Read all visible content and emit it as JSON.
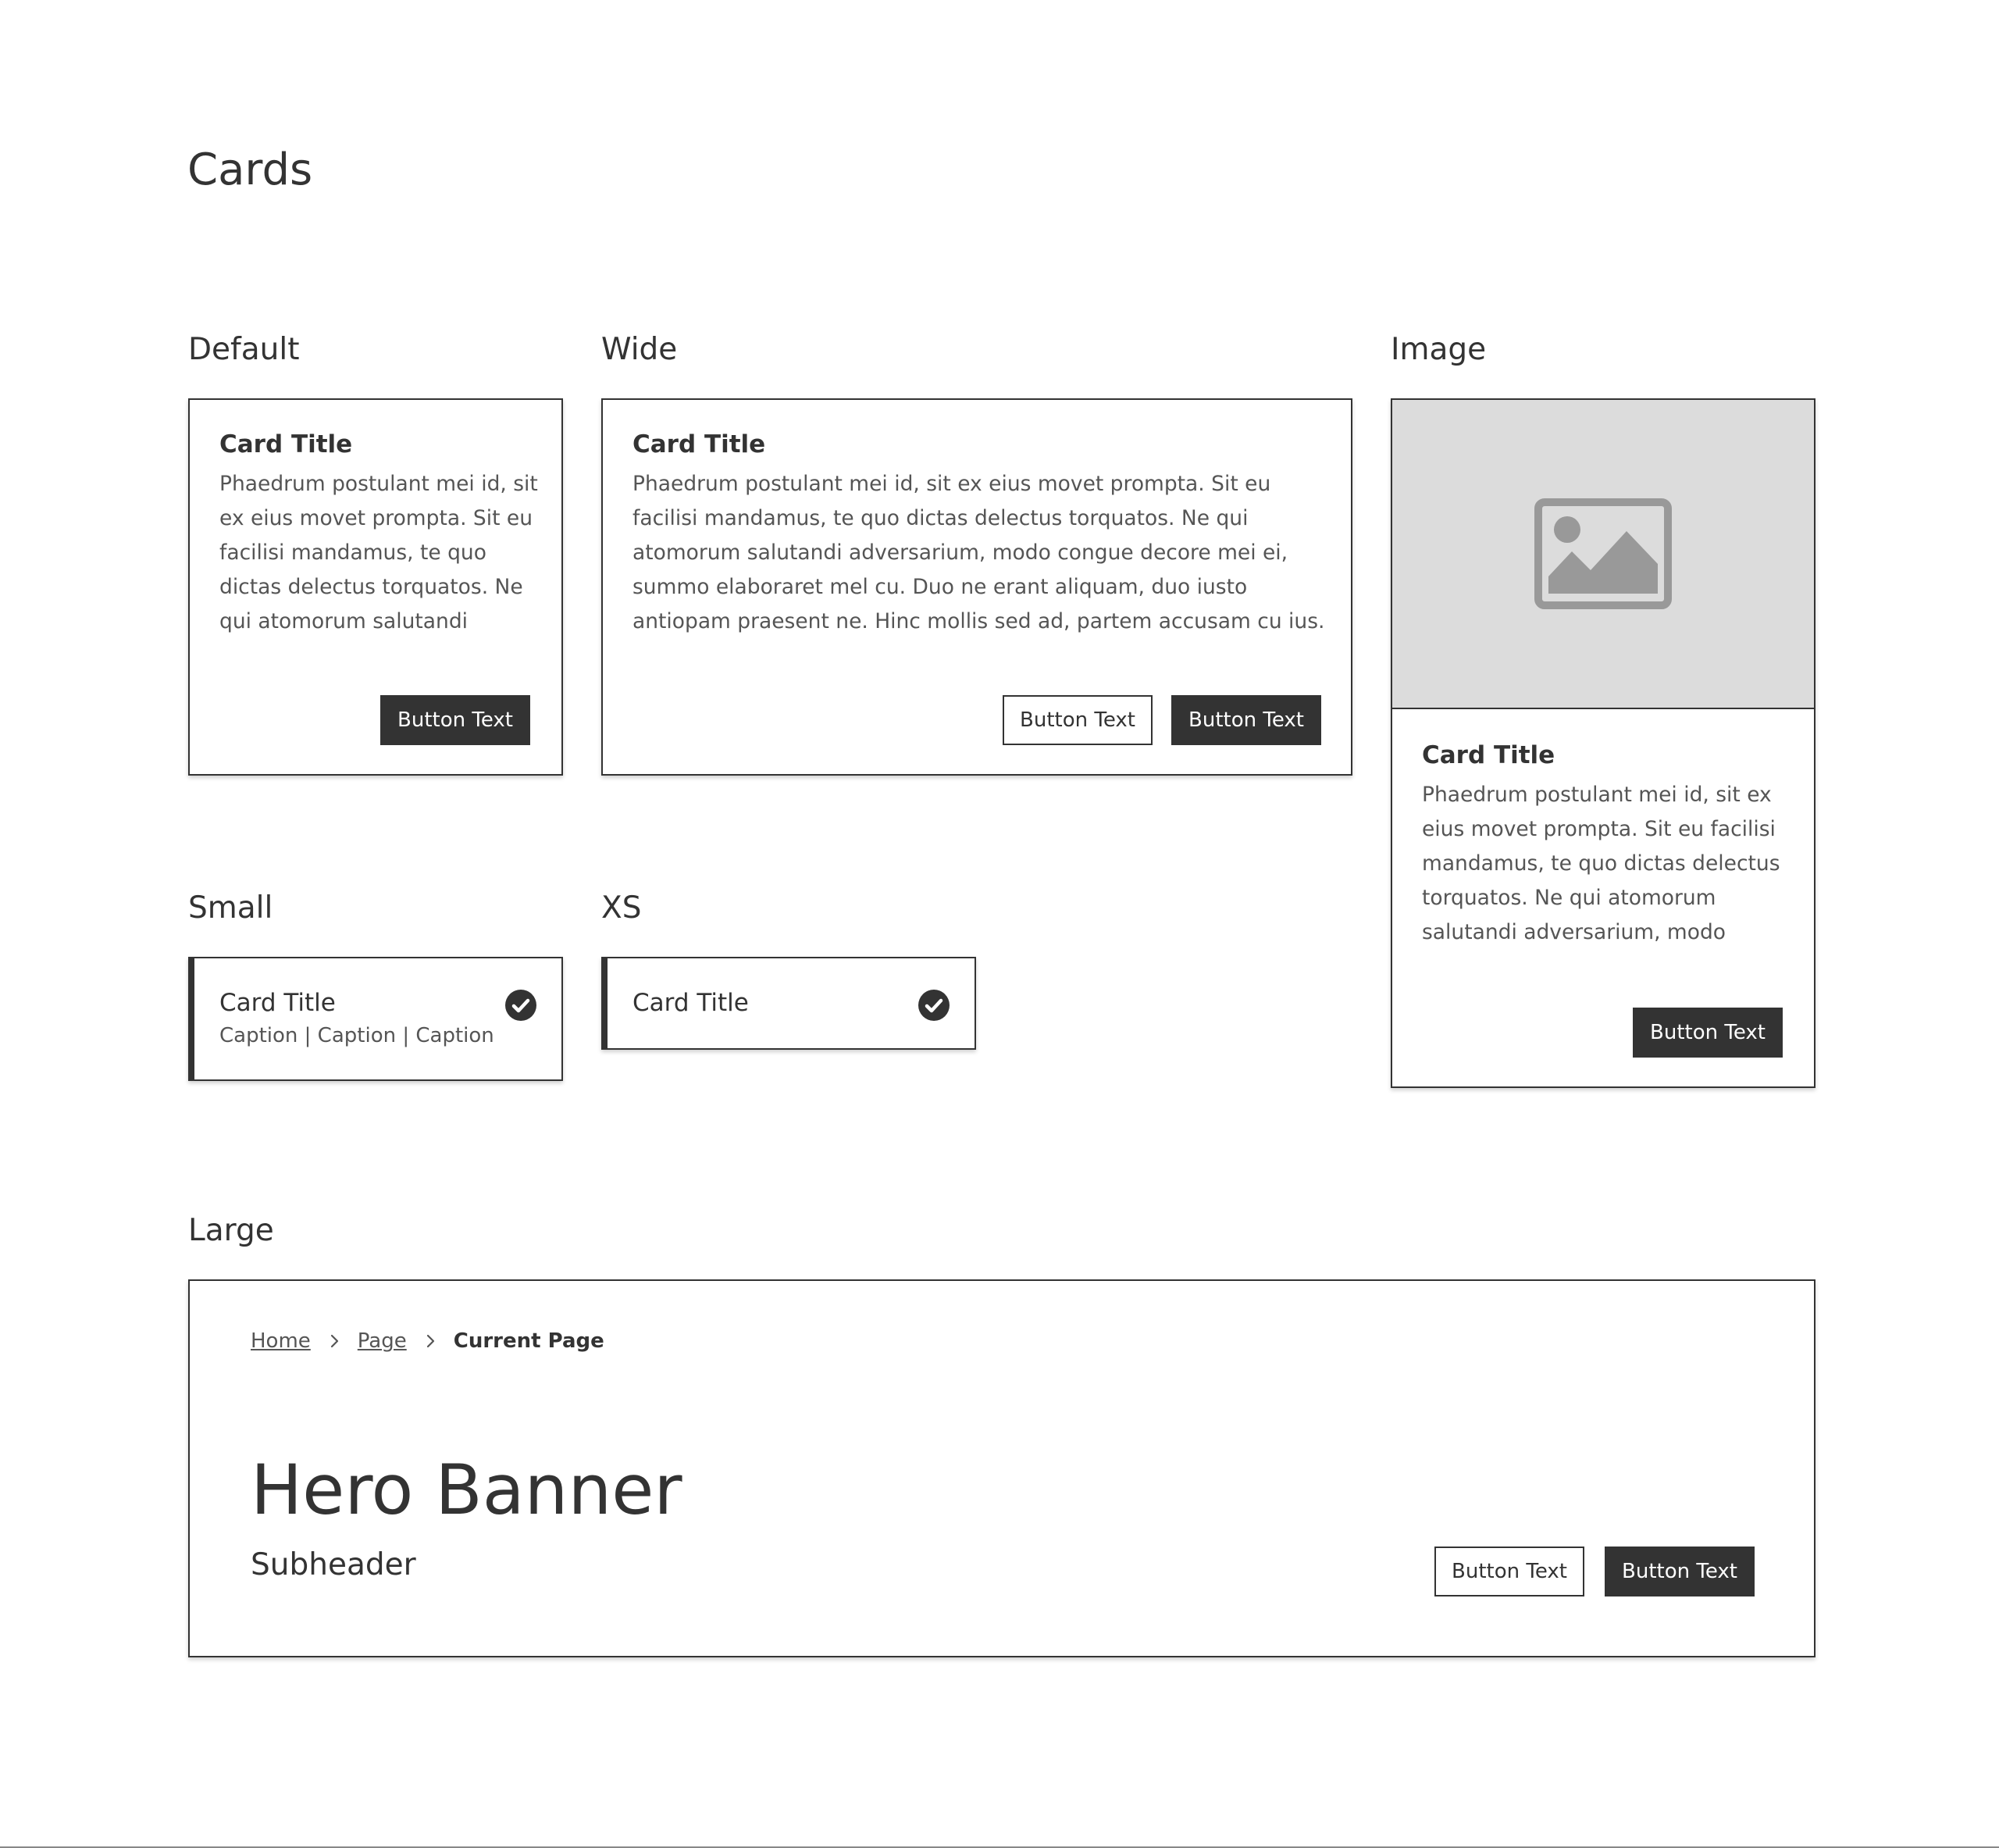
{
  "page": {
    "title": "Cards"
  },
  "sections": {
    "default_label": "Default",
    "wide_label": "Wide",
    "image_label": "Image",
    "small_label": "Small",
    "xs_label": "XS",
    "large_label": "Large"
  },
  "default_card": {
    "title": "Card Title",
    "body": "Phaedrum postulant mei id, sit ex eius movet prompta. Sit eu facilisi mandamus, te quo dictas delectus torquatos. Ne qui atomorum salutandi adversarium. modo conaue",
    "primary_button": "Button Text"
  },
  "wide_card": {
    "title": "Card Title",
    "body": "Phaedrum postulant mei id, sit ex eius movet prompta. Sit eu facilisi mandamus, te quo dictas delectus torquatos. Ne qui atomorum salutandi adversarium, modo congue decore mei ei, summo elaboraret mel cu. Duo ne erant aliquam, duo iusto antiopam praesent ne. Hinc mollis sed ad, partem accusam cu ius. Cu eum case maluisset laboramus.",
    "secondary_button": "Button Text",
    "primary_button": "Button Text"
  },
  "image_card": {
    "image_icon": "image-placeholder-icon",
    "title": "Card Title",
    "body": "Phaedrum postulant mei id, sit ex eius movet prompta. Sit eu facilisi mandamus, te quo dictas delectus torquatos. Ne qui atomorum salutandi adversarium, modo conaue decore mei ei. summo",
    "primary_button": "Button Text"
  },
  "small_card": {
    "title": "Card Title",
    "caption": "Caption | Caption | Caption",
    "icon": "check-circle-icon"
  },
  "xs_card": {
    "title": "Card Title",
    "icon": "check-circle-icon"
  },
  "large_card": {
    "breadcrumb": {
      "home": "Home",
      "page": "Page",
      "current": "Current Page"
    },
    "hero_title": "Hero Banner",
    "subheader": "Subheader",
    "secondary_button": "Button Text",
    "primary_button": "Button Text"
  },
  "colors": {
    "text": "#333333",
    "muted_text": "#555555",
    "primary_button_bg": "#333333",
    "image_bg": "#dcdcdc",
    "icon_gray": "#999999"
  }
}
